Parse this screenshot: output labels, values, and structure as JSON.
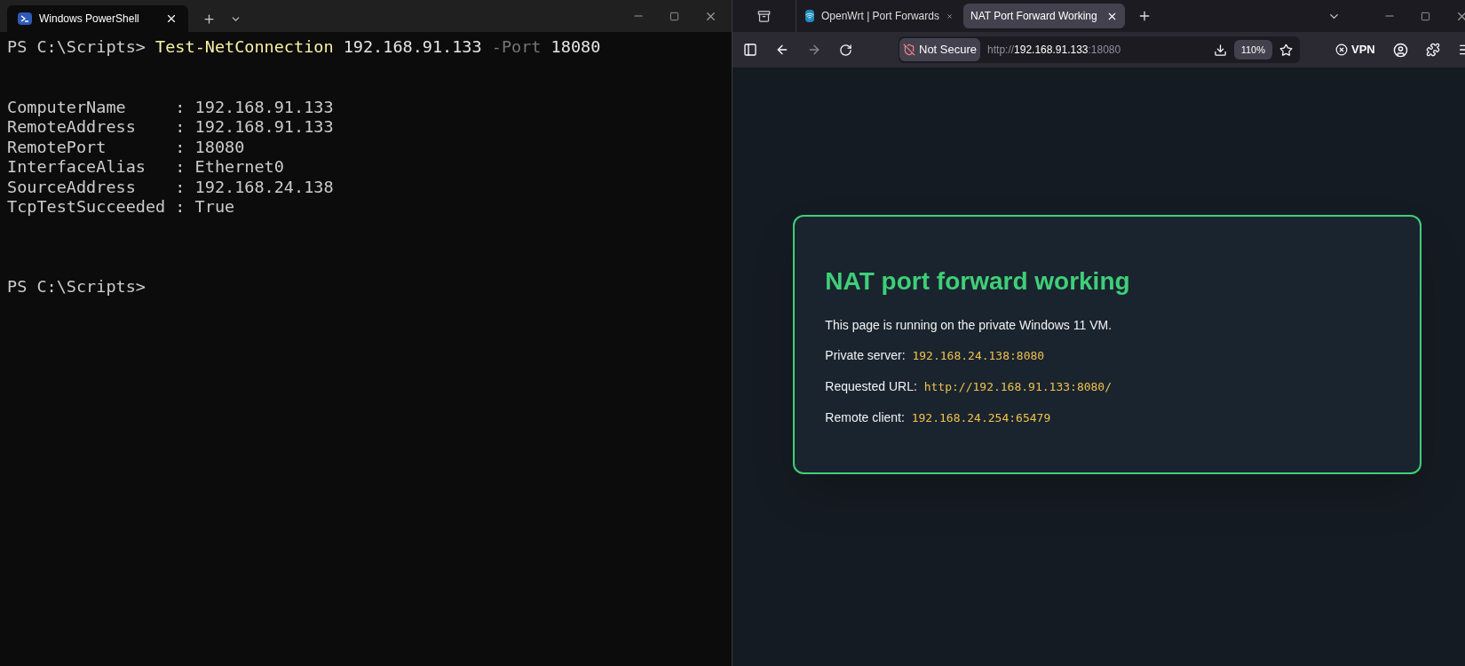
{
  "terminal": {
    "tab": {
      "title": "Windows PowerShell",
      "selected": true
    },
    "command": [
      {
        "kind": "prompt",
        "text": "PS C:\\Scripts>"
      },
      {
        "kind": "cmdlet",
        "text": "Test-NetConnection"
      },
      {
        "kind": "arg",
        "text": "192.168.91.133"
      },
      {
        "kind": "param",
        "text": "-Port"
      },
      {
        "kind": "arg",
        "text": "18080"
      }
    ],
    "output": [
      "ComputerName     : 192.168.91.133",
      "RemoteAddress    : 192.168.91.133",
      "RemotePort       : 18080",
      "InterfaceAlias   : Ethernet0",
      "SourceAddress    : 192.168.24.138",
      "TcpTestSucceeded : True"
    ],
    "prompt": "PS C:\\Scripts>"
  },
  "browser": {
    "tabs": [
      {
        "title": "OpenWrt | Port Forwards",
        "selected": false
      },
      {
        "title": "NAT Port Forward Working",
        "selected": true
      }
    ],
    "security": "Not Secure",
    "url": [
      {
        "kind": "dim",
        "text": "http://"
      },
      {
        "kind": "bright",
        "text": "192.168.91.133"
      },
      {
        "kind": "dim",
        "text": ":18080"
      }
    ],
    "zoom": "110%",
    "vpn": "VPN",
    "page": {
      "title": "NAT port forward working",
      "lines": [
        {
          "label": "This page is running on the private Windows 11 VM."
        },
        {
          "label": "Private server:",
          "value": "192.168.24.138:8080"
        },
        {
          "label": "Requested URL:",
          "value": "http://192.168.91.133:8080/"
        },
        {
          "label": "Remote client:",
          "value": "192.168.24.254:65479"
        }
      ]
    }
  }
}
